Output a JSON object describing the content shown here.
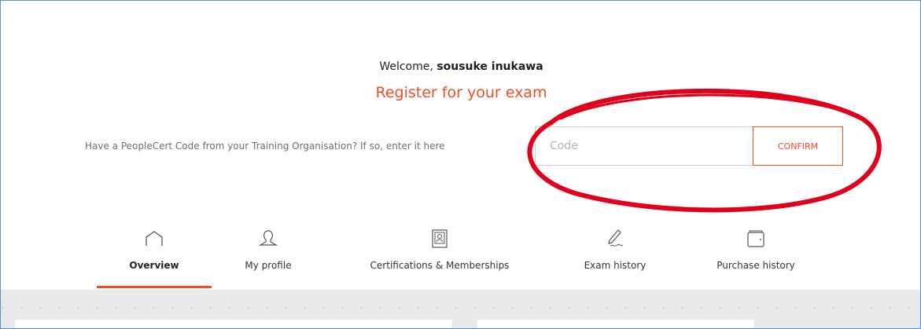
{
  "welcome": {
    "prefix": "Welcome,",
    "user_name": "sousuke inukawa"
  },
  "register_title": "Register for your exam",
  "code_prompt": "Have a PeopleCert Code from your Training Organisation? If so, enter it here",
  "code_input": {
    "placeholder": "Code",
    "value": ""
  },
  "confirm_label": "CONFIRM",
  "colors": {
    "accent": "#f04e23",
    "annotation": "#e0001b"
  },
  "tabs": [
    {
      "label": "Overview",
      "icon": "home-icon",
      "active": true
    },
    {
      "label": "My profile",
      "icon": "user-icon",
      "active": false
    },
    {
      "label": "Certifications & Memberships",
      "icon": "certificate-icon",
      "active": false
    },
    {
      "label": "Exam history",
      "icon": "pen-icon",
      "active": false
    },
    {
      "label": "Purchase history",
      "icon": "wallet-icon",
      "active": false
    }
  ]
}
